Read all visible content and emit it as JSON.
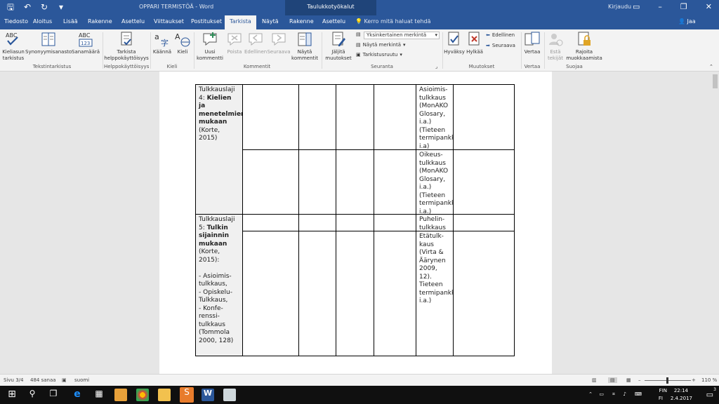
{
  "titlebar": {
    "doc_title": "OPPARI TERMISTÖÄ - Word",
    "context_title": "Taulukkotyökalut",
    "signin": "Kirjaudu",
    "qat": {
      "save": "🖫",
      "undo": "↶",
      "redo": "↻",
      "more": "▾"
    }
  },
  "tabs": [
    "Tiedosto",
    "Aloitus",
    "Lisää",
    "Rakenne",
    "Asettelu",
    "Viittaukset",
    "Postitukset",
    "Tarkista",
    "Näytä",
    "Rakenne",
    "Asettelu"
  ],
  "active_tab": "Tarkista",
  "tellme": "Kerro mitä haluat tehdä",
  "share": "Jaa",
  "ribbon": {
    "proofing": {
      "spelling": "Kieliasun tarkistus",
      "thesaurus": "Synonyymisanasto",
      "wordcount": "Sanamäärä",
      "group": "Tekstintarkistus",
      "abc": "ABC",
      "abc123": "ABC 123"
    },
    "accessibility": {
      "check": "Tarkista helppokäyttöisyys",
      "group": "Helppokäyttöisyys"
    },
    "language": {
      "translate": "Käännä",
      "language": "Kieli",
      "group": "Kieli"
    },
    "comments": {
      "new": "Uusi kommentti",
      "delete": "Poista",
      "previous": "Edellinen",
      "next": "Seuraava",
      "show": "Näytä kommentit",
      "group": "Kommentit"
    },
    "tracking": {
      "track": "Jäljitä muutokset",
      "markup_select": "Yksinkertainen merkintä",
      "show_markup": "Näytä merkintä",
      "pane": "Tarkistusruutu",
      "group": "Seuranta"
    },
    "changes": {
      "accept": "Hyväksy",
      "reject": "Hylkää",
      "previous": "Edellinen",
      "next": "Seuraava",
      "group": "Muutokset"
    },
    "compare": {
      "compare": "Vertaa",
      "group": "Vertaa"
    },
    "protect": {
      "block": "Estä tekijät",
      "restrict": "Rajoita muokkaamista",
      "group": "Suojaa"
    }
  },
  "table": {
    "row4_header": {
      "pre": "Tulkkauslaji 4: ",
      "bold": "Kielien ja menetelmien mukaan",
      "post": " (Korte, 2015)"
    },
    "row4a": "Asioimis-tulkkaus (MonAKO Glosary, i.a.) (Tieteen termipankki, i.a)",
    "row4b": "Oikeus-tulkkaus (MonAKO Glosary, i.a.) (Tieteen termipankki, i.a.)",
    "row5_header": {
      "pre": "Tulkkauslaji 5: ",
      "bold": "Tulkin sijainnin mukaan",
      "post": " (Korte, 2015):",
      "list": "- Asioimis-tulkkaus,\n- Opiskelu-Tulkkaus,\n- Konfe-renssi-tulkkaus (Tommola 2000, 128)"
    },
    "row5a": "Puhelin-tulkkaus",
    "row5b": "Etätulk-kaus (Virta & Äärynen 2009, 12). Tieteen termipankki, i.a.)"
  },
  "statusbar": {
    "page": "Sivu 3/4",
    "words": "484 sanaa",
    "language": "suomi",
    "zoom": "110 %"
  },
  "taskbar": {
    "lang1": "FIN",
    "lang2": "FI",
    "time": "22:14",
    "date": "2.4.2017",
    "notif": "3"
  }
}
